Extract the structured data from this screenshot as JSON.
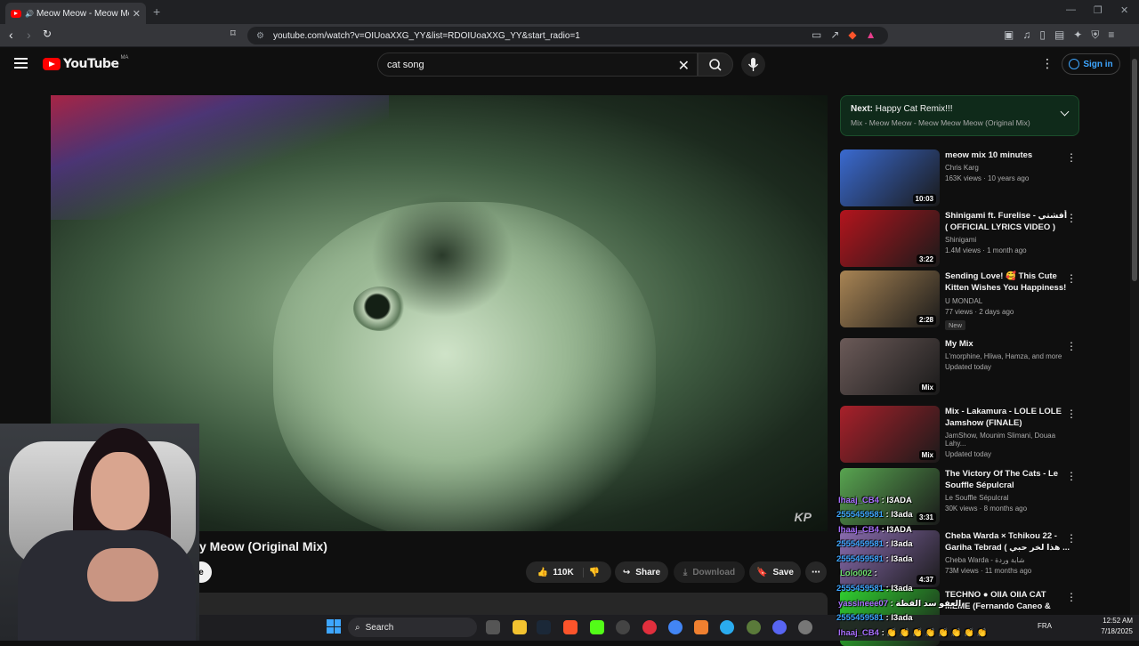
{
  "browser": {
    "tab_title": "Meow Meow - Meow Meow",
    "tab_close": "✕",
    "new_tab": "+",
    "url": "youtube.com/watch?v=OIUoaXXG_YY&list=RDOIUoaXXG_YY&start_radio=1"
  },
  "youtube": {
    "logo_text": "YouTube",
    "country_code": "MA",
    "search_value": "cat song",
    "signin_label": "Sign in"
  },
  "player": {
    "watermark": "KP"
  },
  "video": {
    "title_visible": "y Meow (Original Mix)",
    "like_count": "110K",
    "share_label": "Share",
    "download_label": "Download",
    "save_label": "Save",
    "subscribe_fragment": "e"
  },
  "next_up": {
    "prefix": "Next:",
    "title": "Happy Cat Remix!!!",
    "playlist": "Mix - Meow Meow - Meow Meow Meow (Original Mix)"
  },
  "recommendations": [
    {
      "title": "meow mix 10 minutes",
      "channel": "Chris Karg",
      "meta": "163K views · 10 years ago",
      "duration": "10:03",
      "thumb_color": "#3a6ad0",
      "badge": ""
    },
    {
      "title": "Shinigami ft. Furelise - أفشتي ( OFFICIAL LYRICS VIDEO )",
      "channel": "Shinigami",
      "meta": "1.4M views · 1 month ago",
      "duration": "3:22",
      "thumb_color": "#b3141d",
      "badge": ""
    },
    {
      "title": "Sending Love! 🥰 This Cute Kitten Wishes You Happiness! ...",
      "channel": "U MONDAL",
      "meta": "77 views · 2 days ago",
      "duration": "2:28",
      "thumb_color": "#a88454",
      "badge": "New"
    },
    {
      "title": "My Mix",
      "channel": "L'morphine, Hliwa, Hamza, and more",
      "meta": "Updated today",
      "duration": "Mix",
      "thumb_color": "#6b5a58",
      "badge": ""
    },
    {
      "title": "Mix - Lakamura - LOLE LOLE Jamshow (FINALE)",
      "channel": "JamShow, Mounim Slimani, Douaa Lahy...",
      "meta": "Updated today",
      "duration": "Mix",
      "thumb_color": "#a8202a",
      "badge": ""
    },
    {
      "title": "The Victory Of The Cats - Le Souffle Sépulcral",
      "channel": "Le Souffle Sépulcral",
      "meta": "30K views · 8 months ago",
      "duration": "3:31",
      "thumb_color": "#58a450",
      "badge": ""
    },
    {
      "title": "Cheba Warda × Tchikou 22 - Gariha Tebrad ( هذا لخر حبي ...",
      "channel": "Cheba Warda - شابة وردة",
      "meta": "73M views · 11 months ago",
      "duration": "4:37",
      "thumb_color": "#8a6cb0",
      "badge": ""
    },
    {
      "title": "TECHNO ● OIIA OIIA CAT MEME (Fernando Caneo & Vesk Gree...",
      "channel": "",
      "meta": "",
      "duration": "",
      "thumb_color": "#30d030",
      "badge": ""
    }
  ],
  "chat": [
    {
      "user": "lhaaj_CB4",
      "msg": "I3ADA",
      "ucls": "u1"
    },
    {
      "user": "2555459581",
      "msg": "I3ada",
      "ucls": "u2"
    },
    {
      "user": "lhaaj_CB4",
      "msg": "I3ADA",
      "ucls": "u1"
    },
    {
      "user": "2555459581",
      "msg": "I3ada",
      "ucls": "u2"
    },
    {
      "user": "2555459581",
      "msg": "I3ada",
      "ucls": "u2"
    },
    {
      "user": "Lolo002",
      "msg": "",
      "ucls": "u3"
    },
    {
      "user": "2555459581",
      "msg": "I3ada",
      "ucls": "u2"
    },
    {
      "user": "yassineee07",
      "msg": "العفو سد الفظة",
      "ucls": "u1"
    },
    {
      "user": "2555459581",
      "msg": "I3ada",
      "ucls": "u2"
    },
    {
      "user": "lhaaj_CB4",
      "msg": "👏 👏 👏 👏 👏 👏 👏 👏",
      "ucls": "u1"
    }
  ],
  "taskbar": {
    "search_label": "Search",
    "lang": "FRA",
    "time": "12:52 AM",
    "date": "7/18/2025"
  }
}
